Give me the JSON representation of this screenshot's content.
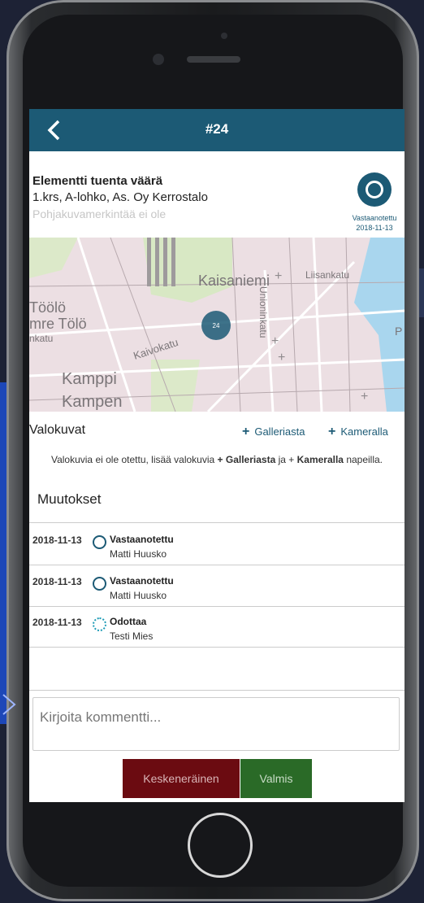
{
  "header": {
    "title": "#24"
  },
  "item": {
    "title": "Elementti tuenta väärä",
    "location": "1.krs, A-lohko, As. Oy Kerrostalo",
    "plan_note": "Pohjakuvamerkintää ei ole",
    "status_label": "Vastaanotettu",
    "status_date": "2018-11-13"
  },
  "map": {
    "labels": [
      "Kaisaniemi",
      "Liisankatu",
      "Töölö",
      "mre Tölö",
      "nkatu",
      "Kamppi",
      "Kampen",
      "Kaivokatu",
      "Unioninkatu",
      "P"
    ],
    "marker": "24"
  },
  "photos": {
    "heading": "Valokuvat",
    "gallery_label": "Galleriasta",
    "camera_label": "Kameralla",
    "hint_pre": "Valokuvia ei ole otettu, lisää valokuvia ",
    "hint_gallery": "+ Galleriasta",
    "hint_mid": " ja + ",
    "hint_camera": "Kameralla",
    "hint_post": " napeilla."
  },
  "changes": {
    "heading": "Muutokset",
    "rows": [
      {
        "date": "2018-11-13",
        "status": "Vastaanotettu",
        "user": "Matti Huusko",
        "icon": "circle-icon"
      },
      {
        "date": "2018-11-13",
        "status": "Vastaanotettu",
        "user": "Matti Huusko",
        "icon": "circle-icon"
      },
      {
        "date": "2018-11-13",
        "status": "Odottaa",
        "user": "Testi Mies",
        "icon": "dashed-circle-icon"
      }
    ]
  },
  "comment": {
    "placeholder": "Kirjoita kommentti..."
  },
  "actions": {
    "incomplete_label": "Keskeneräinen",
    "done_label": "Valmis"
  },
  "colors": {
    "primary": "#1c5a75",
    "incomplete": "#6b0b11",
    "done": "#2a6a27"
  }
}
